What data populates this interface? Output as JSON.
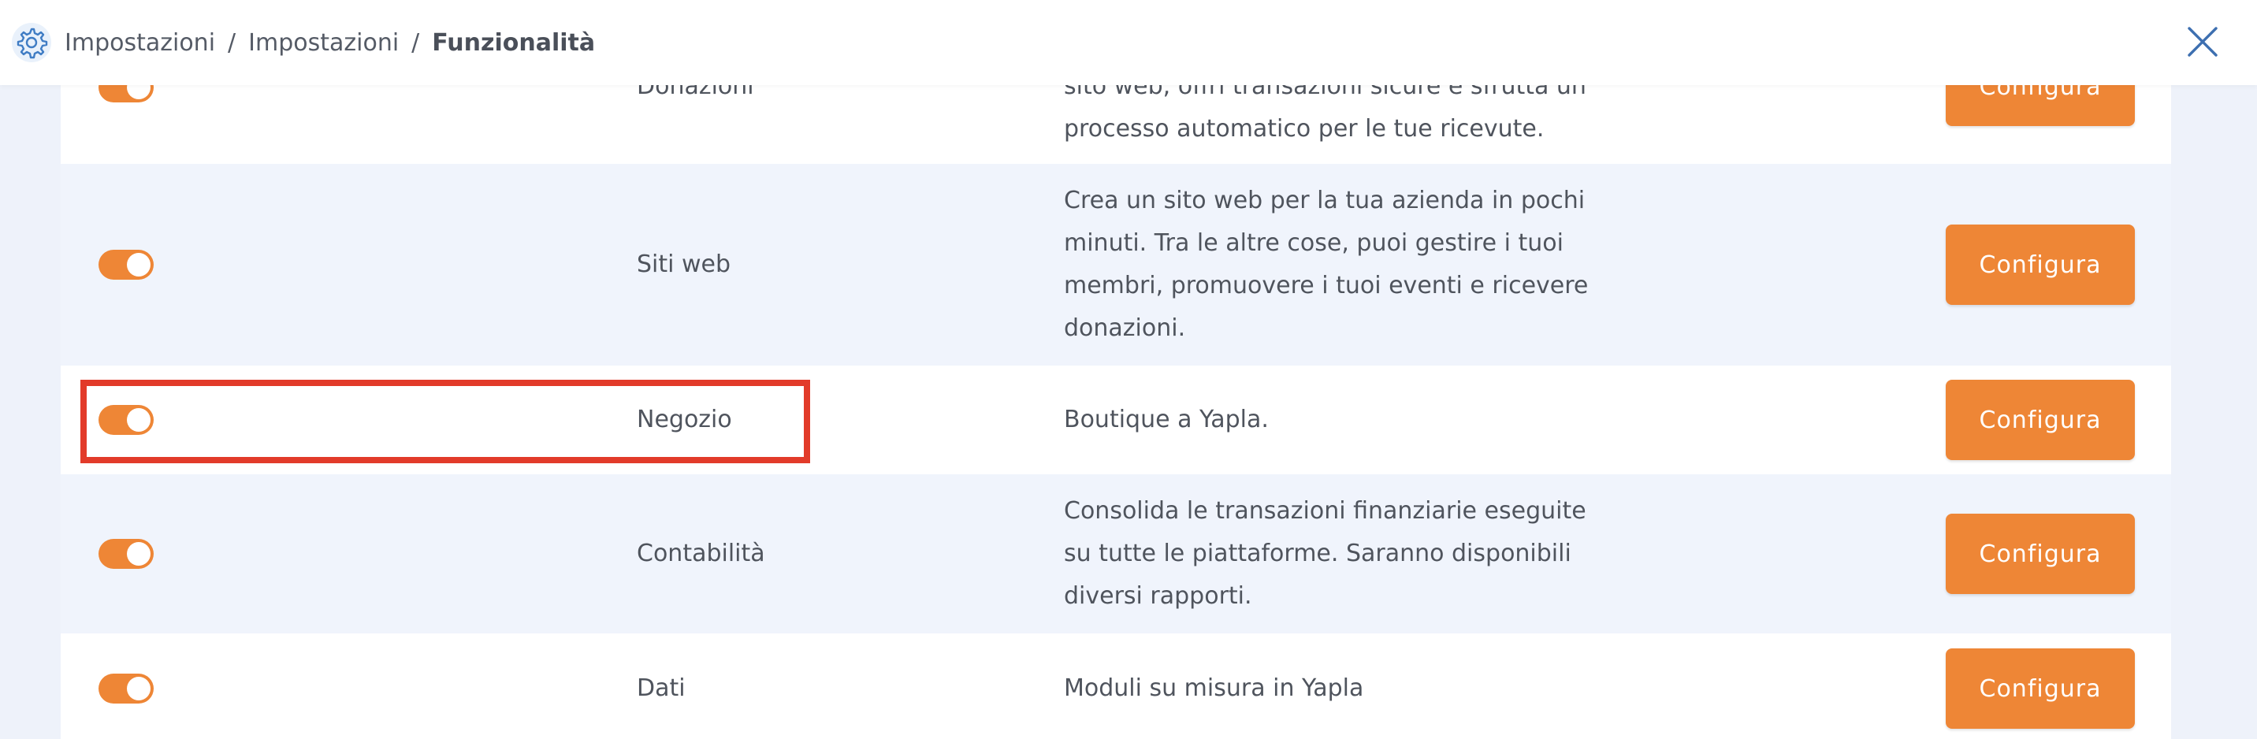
{
  "header": {
    "breadcrumb": [
      "Impostazioni",
      "Impostazioni",
      "Funzionalità"
    ],
    "separator": "/",
    "icons": {
      "settings": "gear-icon",
      "close": "close-icon"
    }
  },
  "colors": {
    "accent": "#ee8636",
    "highlight": "#e23b2a"
  },
  "features": [
    {
      "name": "Donazioni",
      "description_lines": [
        "sito web, offri transazioni sicure e sfrutta un",
        "processo automatico per le tue ricevute."
      ],
      "enabled": true,
      "button": "Configura"
    },
    {
      "name": "Siti web",
      "description_lines": [
        "Crea un sito web per la tua azienda in pochi",
        "minuti. Tra le altre cose, puoi gestire i tuoi",
        "membri, promuovere i tuoi eventi e ricevere",
        "donazioni."
      ],
      "enabled": true,
      "button": "Configura"
    },
    {
      "name": "Negozio",
      "description_lines": [
        "Boutique a Yapla."
      ],
      "enabled": true,
      "button": "Configura"
    },
    {
      "name": "Contabilità",
      "description_lines": [
        "Consolida le transazioni finanziarie eseguite",
        "su tutte le piattaforme. Saranno disponibili",
        "diversi rapporti."
      ],
      "enabled": true,
      "button": "Configura"
    },
    {
      "name": "Dati",
      "description_lines": [
        "Moduli su misura in Yapla"
      ],
      "enabled": true,
      "button": "Configura"
    }
  ]
}
